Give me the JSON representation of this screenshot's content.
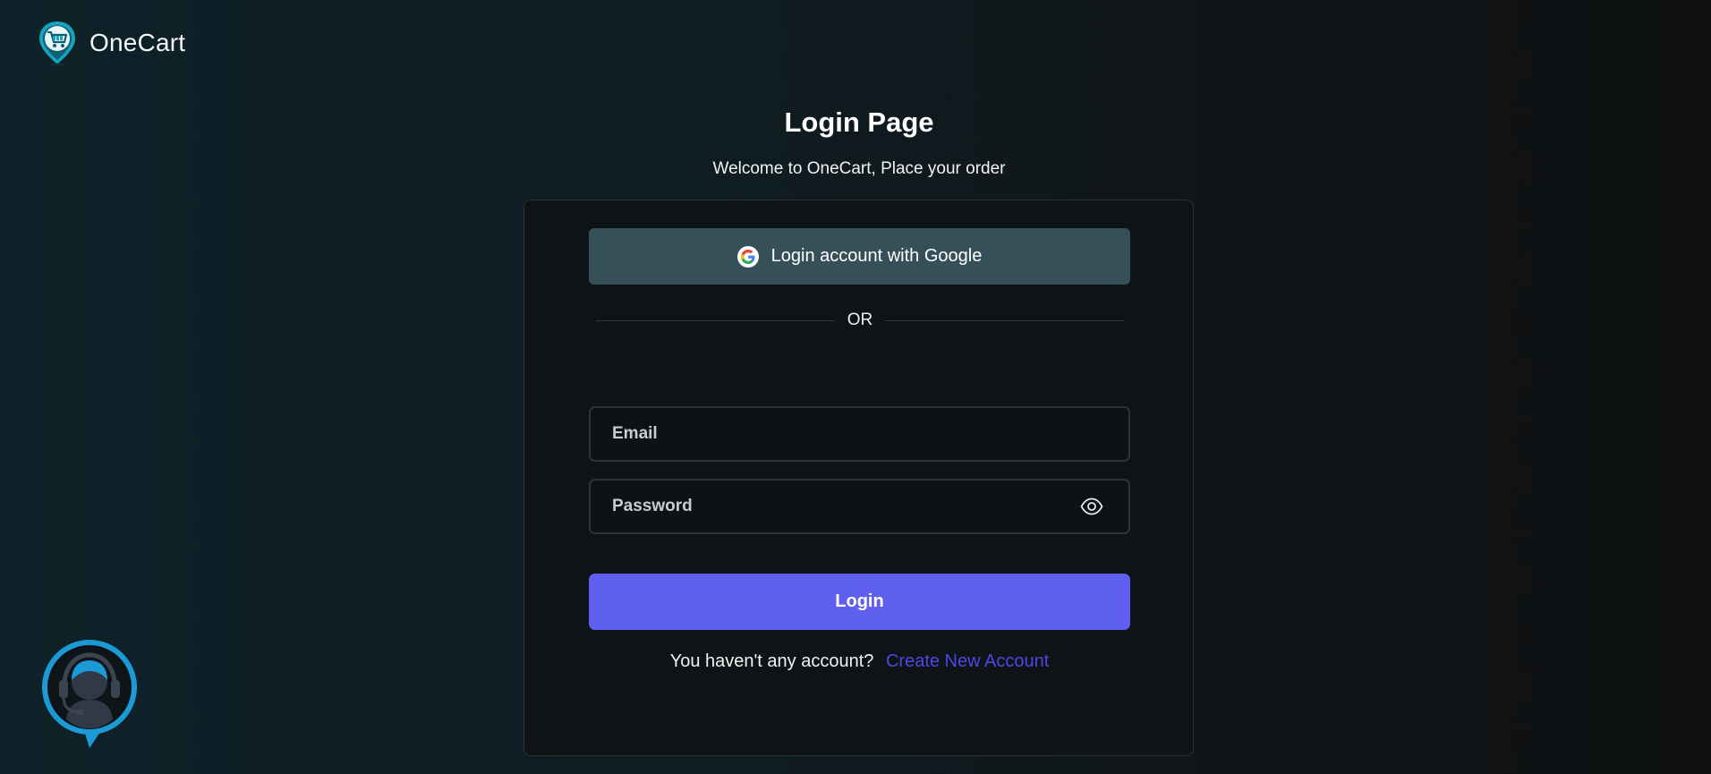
{
  "brand": {
    "name": "OneCart",
    "logo_icon": "cart-pin-logo-icon"
  },
  "header": {
    "title": "Login Page",
    "subtitle": "Welcome to OneCart, Place your order"
  },
  "form": {
    "google_label": "Login account with Google",
    "divider_text": "OR",
    "email_placeholder": "Email",
    "password_placeholder": "Password",
    "password_toggle_icon": "eye-icon",
    "login_label": "Login",
    "signup_prompt": "You haven't any account?",
    "signup_link": "Create New Account"
  },
  "support": {
    "icon": "headset-support-icon"
  },
  "colors": {
    "primary": "#6060f0",
    "link": "#4f46e5",
    "google_button": "#36505a",
    "brand_teal": "#1ba3c7"
  }
}
